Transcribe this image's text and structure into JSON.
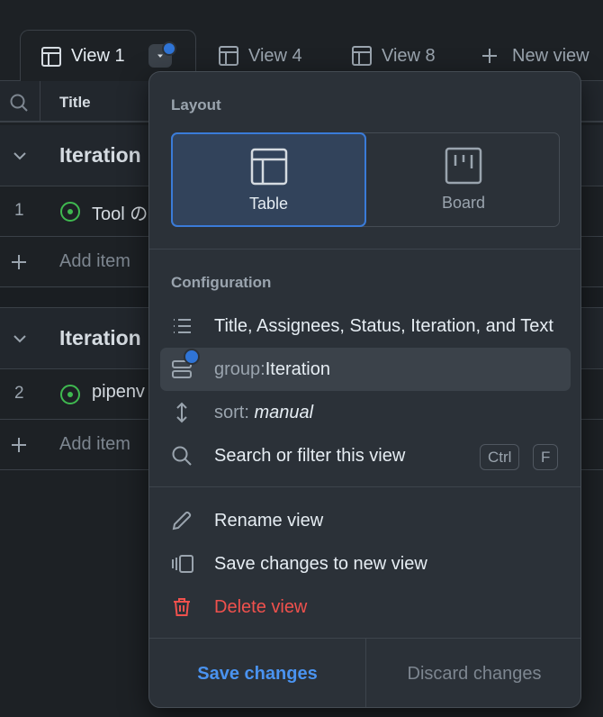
{
  "tabs": {
    "view1": "View 1",
    "view4": "View 4",
    "view8": "View 8",
    "new_view": "New view"
  },
  "table": {
    "title_header": "Title",
    "groups": [
      {
        "label": "Iteration"
      },
      {
        "label": "Iteration"
      }
    ],
    "rows": [
      {
        "num": "1",
        "title": "Tool の"
      },
      {
        "num": "2",
        "title": "pipenv"
      }
    ],
    "add_item": "Add item"
  },
  "menu": {
    "layout_label": "Layout",
    "layouts": {
      "table": "Table",
      "board": "Board"
    },
    "configuration_label": "Configuration",
    "fields": "Title, Assignees, Status, Iteration, and Text",
    "group_prefix": "group:",
    "group_value": "Iteration",
    "sort_prefix": "sort:",
    "sort_value": "manual",
    "search": "Search or filter this view",
    "shortcut_ctrl": "Ctrl",
    "shortcut_f": "F",
    "rename": "Rename view",
    "save_new": "Save changes to new view",
    "delete": "Delete view",
    "save_changes": "Save changes",
    "discard_changes": "Discard changes"
  },
  "colors": {
    "background": "#1d2125",
    "menu_background": "#2b3138",
    "accent": "#2f74d6",
    "danger": "#f0514d",
    "status_open": "#3fb950"
  }
}
